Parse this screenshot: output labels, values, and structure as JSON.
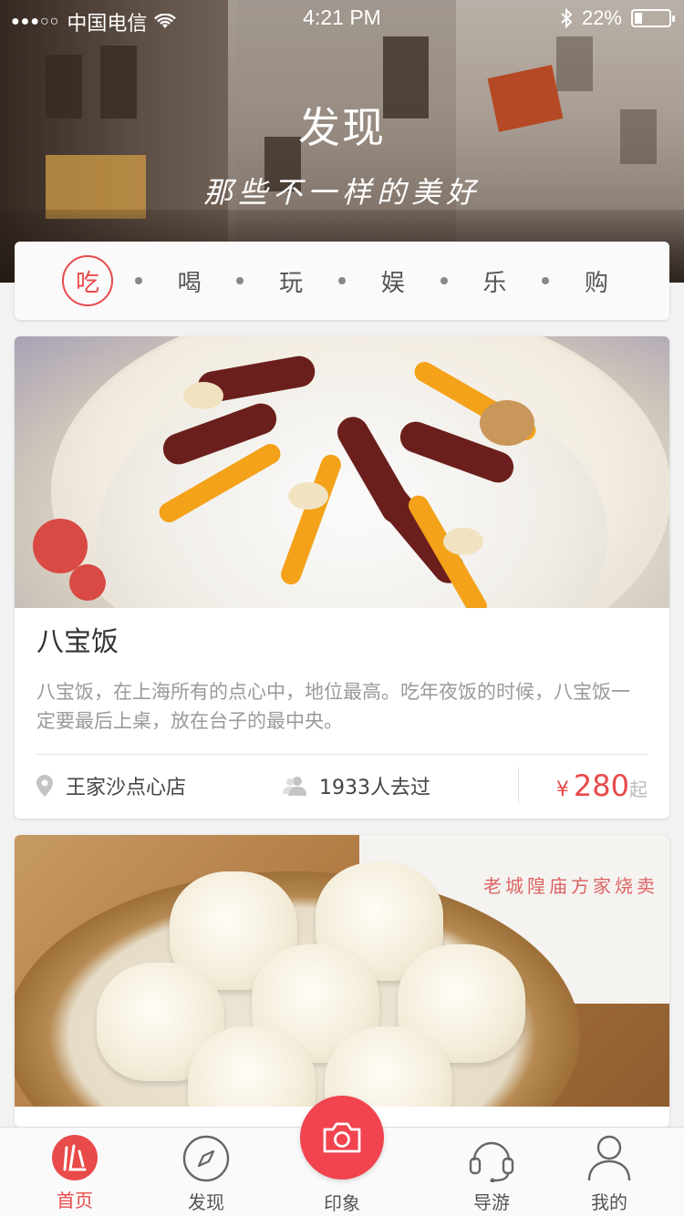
{
  "status_bar": {
    "signal": "●●●○○",
    "carrier": "中国电信",
    "time": "4:21 PM",
    "battery": "22%",
    "battery_level": 0.22
  },
  "header": {
    "title": "发现",
    "subtitle": "那些不一样的美好"
  },
  "categories": [
    {
      "label": "吃",
      "active": true
    },
    {
      "label": "喝",
      "active": false
    },
    {
      "label": "玩",
      "active": false
    },
    {
      "label": "娱",
      "active": false
    },
    {
      "label": "乐",
      "active": false
    },
    {
      "label": "购",
      "active": false
    }
  ],
  "cards": [
    {
      "title": "八宝饭",
      "description": "八宝饭，在上海所有的点心中，地位最高。吃年夜饭的时候，八宝饭一定要最后上桌，放在台子的最中央。",
      "location": "王家沙点心店",
      "visitors": "1933人去过",
      "price_symbol": "¥",
      "price": "280",
      "price_unit": "起"
    },
    {
      "box_text": "老城隍庙方家烧卖"
    }
  ],
  "bottom_nav": {
    "items": [
      {
        "label": "首页",
        "icon": "home-logo-icon",
        "active": true
      },
      {
        "label": "发现",
        "icon": "compass-icon",
        "active": false
      },
      {
        "label": "印象",
        "icon": "camera-icon",
        "active": false
      },
      {
        "label": "导游",
        "icon": "headset-icon",
        "active": false
      },
      {
        "label": "我的",
        "icon": "user-icon",
        "active": false
      }
    ]
  },
  "colors": {
    "accent": "#e94a4a",
    "camera_button": "#f1444f"
  }
}
